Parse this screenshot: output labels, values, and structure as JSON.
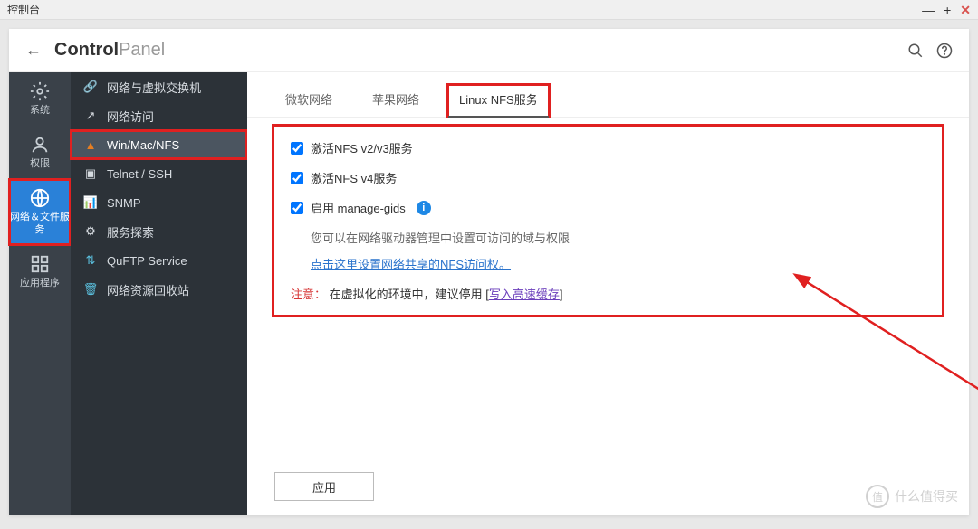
{
  "titlebar": {
    "title": "控制台"
  },
  "header": {
    "title_bold": "Control",
    "title_light": "Panel"
  },
  "leftnav": {
    "items": [
      {
        "label": "系统",
        "icon": "gear"
      },
      {
        "label": "权限",
        "icon": "user"
      },
      {
        "label": "网络＆文件服务",
        "icon": "globe",
        "active": true,
        "highlighted": true
      },
      {
        "label": "应用程序",
        "icon": "apps"
      }
    ]
  },
  "sidebar": {
    "items": [
      {
        "label": "网络与虚拟交换机",
        "icon": "network-switch"
      },
      {
        "label": "网络访问",
        "icon": "network-access"
      },
      {
        "label": "Win/Mac/NFS",
        "icon": "triangle",
        "active": true,
        "highlighted": true
      },
      {
        "label": "Telnet / SSH",
        "icon": "terminal"
      },
      {
        "label": "SNMP",
        "icon": "chart"
      },
      {
        "label": "服务探索",
        "icon": "discovery"
      },
      {
        "label": "QuFTP Service",
        "icon": "ftp"
      },
      {
        "label": "网络资源回收站",
        "icon": "recycle"
      }
    ]
  },
  "tabs": {
    "items": [
      {
        "label": "微软网络"
      },
      {
        "label": "苹果网络"
      },
      {
        "label": "Linux NFS服务",
        "active": true,
        "highlighted": true
      }
    ]
  },
  "content": {
    "check1": "激活NFS v2/v3服务",
    "check2": "激活NFS v4服务",
    "check3": "启用 manage-gids",
    "subtext": "您可以在网络驱动器管理中设置可访问的域与权限",
    "link_text": "点击这里设置网络共享的NFS访问权。",
    "warning_label": "注意：",
    "warning_text": "在虚拟化的环境中，建议停用 [",
    "warning_link": "写入高速缓存",
    "warning_close": "]"
  },
  "footer": {
    "apply_label": "应用"
  },
  "watermark": {
    "text": "什么值得买",
    "badge": "值"
  }
}
